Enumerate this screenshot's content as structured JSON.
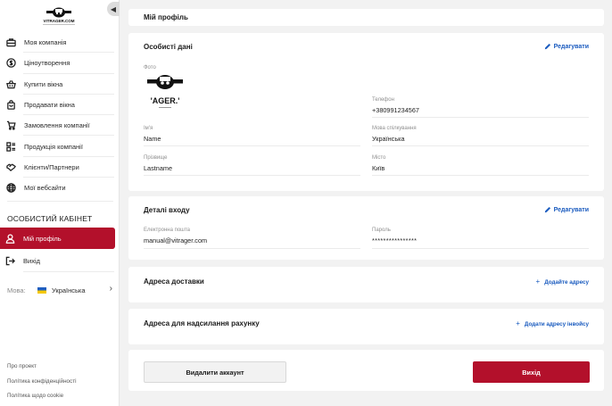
{
  "sidebar": {
    "logo_text": "VITRAGER.COM",
    "collapse_icon": "chevron-left-icon",
    "nav": [
      {
        "label": "Моя компанія",
        "icon": "briefcase-icon"
      },
      {
        "label": "Ціноутворення",
        "icon": "dollar-icon"
      },
      {
        "label": "Купити вікна",
        "icon": "basket-icon"
      },
      {
        "label": "Продавати вікна",
        "icon": "shopping-bag-icon"
      },
      {
        "label": "Замовлення компанії",
        "icon": "cart-icon"
      },
      {
        "label": "Продукція компанії",
        "icon": "catalog-icon"
      },
      {
        "label": "Клієнти/Партнери",
        "icon": "handshake-icon"
      },
      {
        "label": "Мої вебсайти",
        "icon": "globe-icon"
      }
    ],
    "section_title": "ОСОБИСТИЙ КАБІНЕТ",
    "active_item": {
      "label": "Мій профіль",
      "icon": "user-icon"
    },
    "logout_item": {
      "label": "Вихід",
      "icon": "logout-icon"
    },
    "language": {
      "label": "Мова:",
      "value": "Українська"
    },
    "footer_links": [
      "Про проект",
      "Політика конфіденційності",
      "Політика щодо cookie"
    ]
  },
  "main": {
    "page_title": "Мій профіль",
    "personal": {
      "title": "Особисті дані",
      "edit_label": "Редагувати",
      "photo_label": "Фото",
      "photo_logo_text": "'AGER.'",
      "fields": {
        "phone": {
          "label": "Телефон",
          "value": "+380991234567"
        },
        "name": {
          "label": "Ім'я",
          "value": "Name"
        },
        "language": {
          "label": "Мова спілкування",
          "value": "Українська"
        },
        "surname": {
          "label": "Прізвище",
          "value": "Lastname"
        },
        "city": {
          "label": "Місто",
          "value": "Київ"
        }
      }
    },
    "login": {
      "title": "Деталі входу",
      "edit_label": "Редагувати",
      "email": {
        "label": "Електронна пошта",
        "value": "manual@vitrager.com"
      },
      "password": {
        "label": "Пароль",
        "value": "****************"
      }
    },
    "delivery": {
      "title": "Адреса доставки",
      "add_label": "Додайте адресу"
    },
    "invoice": {
      "title": "Адреса для надсилання рахунку",
      "add_label": "Додати адресу інвойсу"
    },
    "actions": {
      "delete_label": "Видалити аккаунт",
      "exit_label": "Вихід"
    }
  },
  "colors": {
    "accent": "#b3102b",
    "link": "#1a5bbf",
    "background": "#f2f2f2"
  }
}
